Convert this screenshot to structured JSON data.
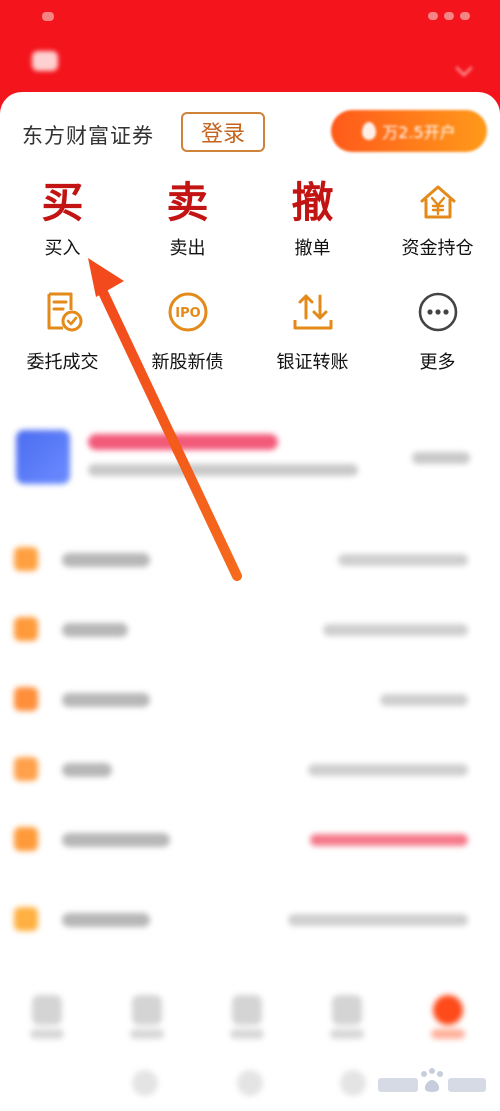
{
  "header": {
    "brand_name": "",
    "tabs": []
  },
  "account": {
    "broker_name": "东方财富证券",
    "login_label": "登录",
    "open_account_label": "万2.5开户"
  },
  "quick_actions": [
    {
      "glyph": "买",
      "label": "买入",
      "icon": "buy-glyph"
    },
    {
      "glyph": "卖",
      "label": "卖出",
      "icon": "sell-glyph"
    },
    {
      "glyph": "撤",
      "label": "撤单",
      "icon": "cancel-glyph"
    },
    {
      "label": "资金持仓",
      "icon": "house-yen-icon"
    },
    {
      "label": "委托成交",
      "icon": "order-document-icon"
    },
    {
      "label": "新股新债",
      "icon": "ipo-icon",
      "icon_text": "IPO"
    },
    {
      "label": "银证转账",
      "icon": "transfer-arrows-icon"
    },
    {
      "label": "更多",
      "icon": "more-dots-icon"
    }
  ],
  "colors": {
    "header_red": "#f4141c",
    "action_red": "#c31414",
    "icon_orange": "#e38a1a",
    "annotation_arrow": "#f2521c",
    "login_border": "#d0813a"
  },
  "annotation": {
    "type": "arrow",
    "points_to": "buy-action"
  }
}
